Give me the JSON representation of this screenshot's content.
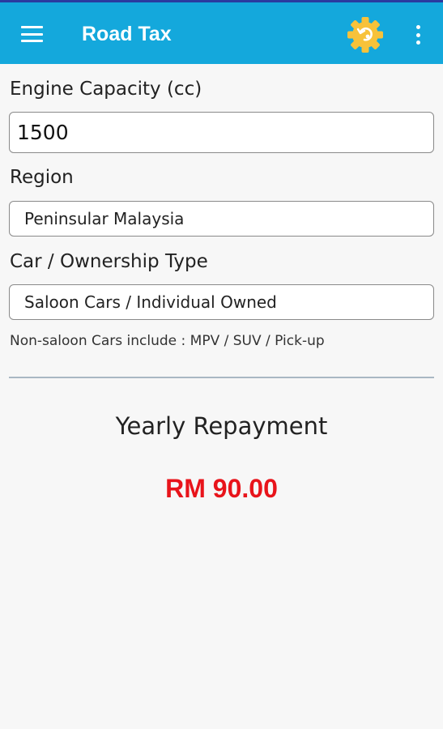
{
  "appbar": {
    "title": "Road Tax",
    "menu_icon": "hamburger-menu-icon",
    "settings_icon": "gear-icon",
    "overflow_icon": "more-vertical-icon",
    "bar_color": "#14a8dc",
    "gear_color": "#f7c23a"
  },
  "form": {
    "engine_label": "Engine Capacity (cc)",
    "engine_value": "1500",
    "region_label": "Region",
    "region_value": "Peninsular Malaysia",
    "ownership_label": "Car / Ownership Type",
    "ownership_value": "Saloon Cars / Individual Owned",
    "note": "Non-saloon Cars include : MPV / SUV / Pick-up"
  },
  "result": {
    "label": "Yearly Repayment",
    "value": "RM 90.00",
    "value_color": "#e8141b"
  }
}
